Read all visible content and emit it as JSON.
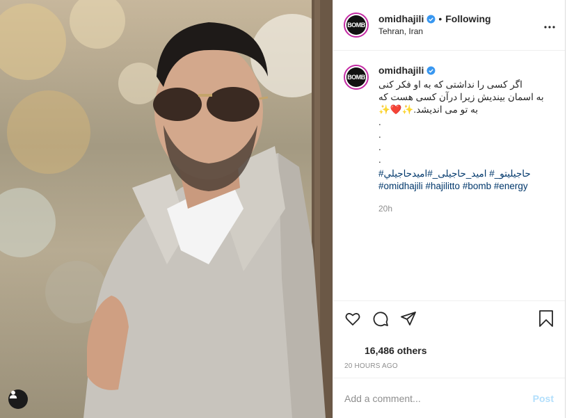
{
  "post": {
    "username": "omidhajili",
    "location": "Tehran, Iran",
    "following_label": "Following",
    "avatar_text": "BOMB",
    "caption": {
      "lines": "اگر کسی را نداشتی که به او فکر کنی\nبه اسمان بیندیش زیرا درآن کسی هست که\n✨❤️✨.به تو می اندیشد\n.\n.\n.\n.",
      "hashtags_line1": "#حاجیلیتو_# امید_حاجیلی_#امیدحاجیلي",
      "hashtags_line2": "#omidhajili #hajilitto #bomb #energy",
      "time": "20h"
    },
    "likes": "16,486 others",
    "date": "20 HOURS AGO",
    "comment": {
      "placeholder": "Add a comment...",
      "post_label": "Post"
    }
  },
  "icons": {
    "verified": "verified-badge-icon",
    "more": "more-options-icon",
    "like": "heart-icon",
    "comment": "comment-icon",
    "share": "share-icon",
    "save": "bookmark-icon",
    "tags": "user-tag-icon"
  },
  "colors": {
    "verified_blue": "#3897f0",
    "link": "#00376b",
    "post_disabled": "#b2dffc",
    "muted": "#8e8e8e"
  }
}
